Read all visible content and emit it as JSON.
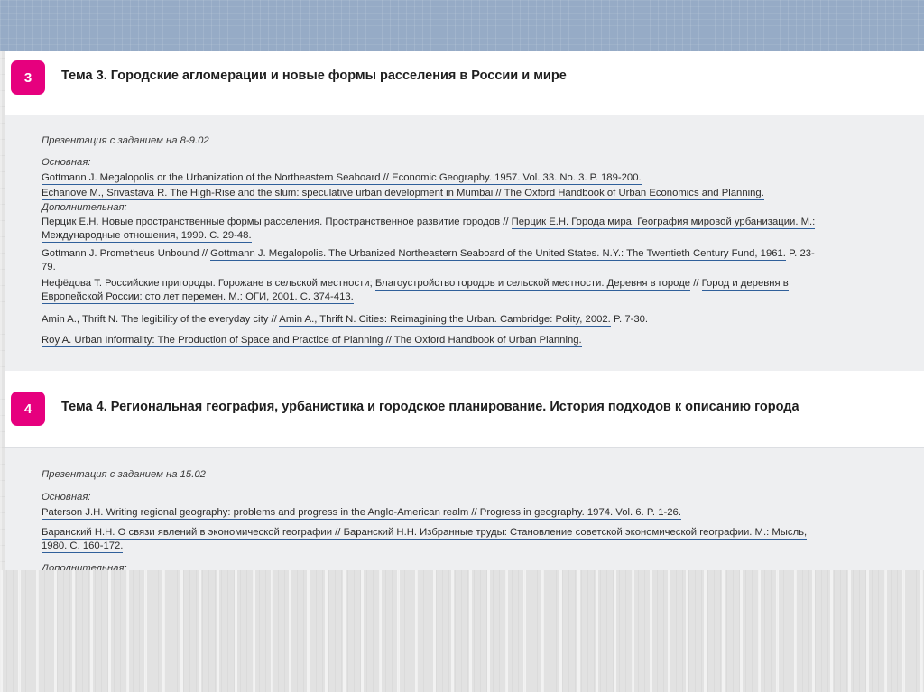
{
  "topic3": {
    "number": "3",
    "title": "Тема 3. Городские агломерации и новые формы расселения в России и мире",
    "presentation": "Презентация с заданием на 8-9.02",
    "main_label": "Основная:",
    "main": [
      "Gottmann J. Megalopolis or the Urbanization of the Northeastern Seaboard // Economic Geography. 1957. Vol. 33. No. 3. P. 189-200.",
      "Echanove M., Srivastava R. The High-Rise and the slum: speculative urban development in Mumbai // The Oxford Handbook of Urban Economics and Planning."
    ],
    "extra_label": "Дополнительная:",
    "extra": {
      "perzik_a": "Перцик Е.Н. Новые пространственные формы расселения. Пространственное развитие городов // ",
      "perzik_link": "Перцик Е.Н. Города мира. География мировой урбанизации. М.:",
      "perzik_cont": "Международные отношения, 1999. С. 29-48.",
      "gottmann_a": "Gottmann J. Prometheus Unbound // ",
      "gottmann_link": "Gottmann J. Megalopolis. The Urbanized Northeastern Seaboard of the United States. N.Y.: The Twentieth Century Fund, 1961.",
      "gottmann_pages": " P. 23-",
      "gottmann_cont": "79.",
      "nefedova_a": "Нефёдова Т. Российские пригороды. Горожане в сельской местности; ",
      "nefedova_link": "Благоустройство городов и сельской местности. Деревня в городе",
      "nefedova_sep": " // ",
      "nefedova_link2": "Город и деревня в",
      "nefedova_cont": "Европейской России: сто лет перемен. М.: ОГИ, 2001. С. 374-413.",
      "amin_a": "Amin A., Thrift N. The legibility of the everyday city // ",
      "amin_link": "Amin A., Thrift N. Cities: Reimagining the Urban. Cambridge: Polity, 2002.",
      "amin_pages": " P. 7-30.",
      "roy": "Roy A. Urban Informality: The Production of Space and Practice of Planning // The Oxford Handbook of Urban Planning."
    }
  },
  "topic4": {
    "number": "4",
    "title": "Тема 4. Региональная география, урбанистика и городское планирование. История подходов к описанию города",
    "presentation": "Презентация с заданием на 15.02",
    "main_label": "Основная:",
    "main": [
      "Paterson J.H. Writing regional geography: problems and progress in the Anglo-American realm // Progress in geography. 1974. Vol. 6. P. 1-26.",
      "Баранский Н.Н. О связи явлений в экономической географии // Баранский Н.Н. Избранные труды: Становление советской экономической географии. М.: Мысль,",
      "1980. С. 160-172."
    ],
    "extra_label": "Дополнительная:"
  }
}
